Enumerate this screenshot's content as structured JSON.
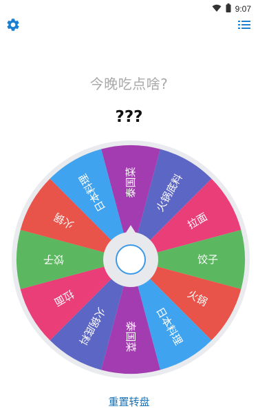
{
  "status_bar": {
    "time": "9:07",
    "icons": [
      "wifi-icon",
      "battery-icon"
    ]
  },
  "toolbar": {
    "settings_icon": "gear-icon",
    "list_icon": "list-icon",
    "icon_color": "#1a7fd0"
  },
  "question": "今晚吃点啥?",
  "result": "???",
  "wheel": {
    "segments": [
      {
        "label": "泰国菜",
        "color": "#a33cb0"
      },
      {
        "label": "火锅底料",
        "color": "#5c66c4"
      },
      {
        "label": "拉面",
        "color": "#ea3e79"
      },
      {
        "label": "饺子",
        "color": "#5cb860"
      },
      {
        "label": "火锅",
        "color": "#e8534a"
      },
      {
        "label": "日本料理",
        "color": "#3fa3ef"
      },
      {
        "label": "泰国菜",
        "color": "#a33cb0"
      },
      {
        "label": "火锅底料",
        "color": "#5c66c4"
      },
      {
        "label": "拉面",
        "color": "#ea3e79"
      },
      {
        "label": "饺子",
        "color": "#5cb860"
      },
      {
        "label": "火锅",
        "color": "#e8534a"
      },
      {
        "label": "日本料理",
        "color": "#3fa3ef"
      }
    ],
    "rim_color": "#e9ebee",
    "hub_color": "#e7e9ec",
    "button_border": "#3a98e6"
  },
  "reset_label": "重置转盘"
}
